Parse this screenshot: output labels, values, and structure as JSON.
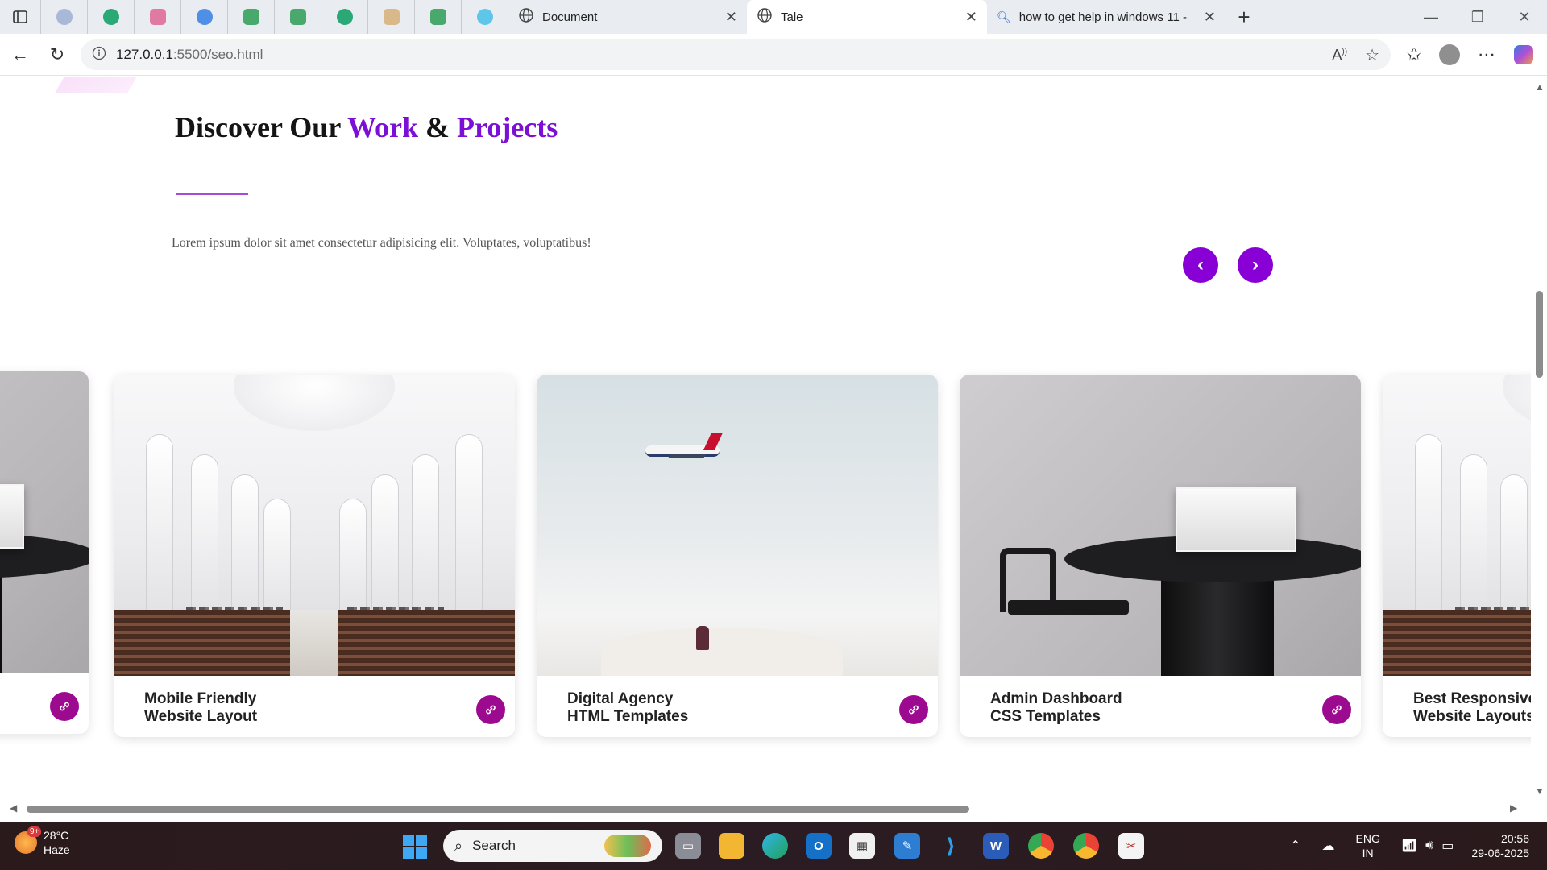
{
  "browser": {
    "tabs": [
      {
        "title": "Document",
        "active": false
      },
      {
        "title": "Tale",
        "active": true
      },
      {
        "title": "how to get help in windows 11 -",
        "active": false
      }
    ],
    "new_tab_label": "+",
    "address": {
      "host": "127.0.0.1",
      "rest": ":5500/seo.html"
    }
  },
  "page": {
    "heading": {
      "part1": "Discover Our ",
      "work": "Work",
      "amp": " & ",
      "projects": "Projects"
    },
    "lead": "Lorem ipsum dolor sit amet consectetur adipisicing elit. Voluptates, voluptatibus!",
    "prev_label": "‹",
    "next_label": "›",
    "cards": [
      {
        "line1": "",
        "line2": "",
        "image": "office"
      },
      {
        "line1": "Mobile Friendly",
        "line2": "Website Layout",
        "image": "church"
      },
      {
        "line1": "Digital Agency",
        "line2": "HTML Templates",
        "image": "sky"
      },
      {
        "line1": "Admin Dashboard",
        "line2": "CSS Templates",
        "image": "office"
      },
      {
        "line1": "Best Responsive",
        "line2": "Website Layouts",
        "image": "church"
      }
    ]
  },
  "colors": {
    "accent": "#7b0fd6",
    "nav_button": "#8800d6",
    "link_button": "#9c0a8f"
  },
  "taskbar": {
    "weather": {
      "temp": "28°C",
      "condition": "Haze",
      "badge": "9+"
    },
    "search_placeholder": "Search",
    "lang": {
      "line1": "ENG",
      "line2": "IN"
    },
    "clock": {
      "time": "20:56",
      "date": "29-06-2025"
    }
  }
}
